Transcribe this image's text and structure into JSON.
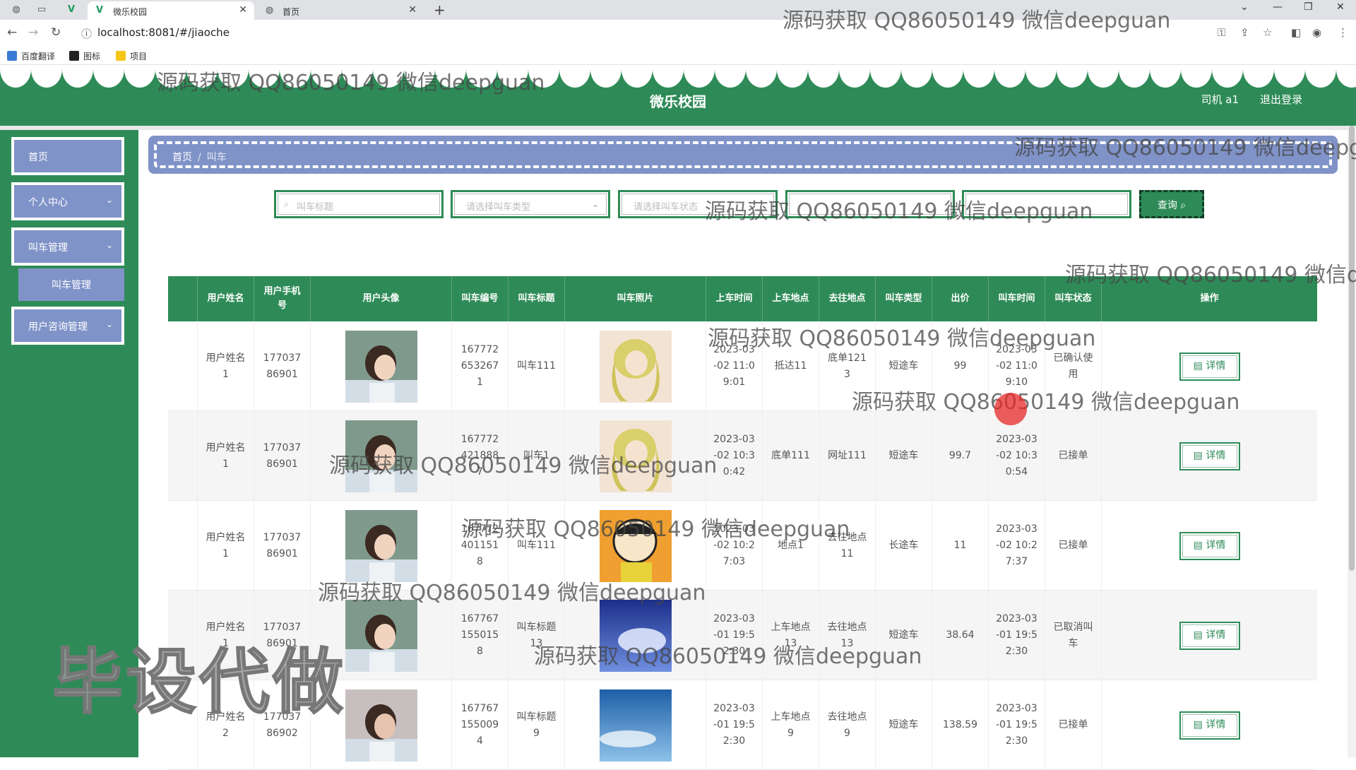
{
  "browser": {
    "tabs": [
      {
        "title": "微乐校园",
        "active": true
      },
      {
        "title": "首页",
        "active": false
      }
    ],
    "url": "localhost:8081/#/jiaoche",
    "bookmarks": [
      "百度翻译",
      "图标",
      "项目"
    ]
  },
  "header": {
    "title": "微乐校园",
    "user": "司机 a1",
    "logout": "退出登录"
  },
  "sidebar": {
    "items": [
      {
        "label": "首页",
        "has_children": false
      },
      {
        "label": "个人中心",
        "has_children": true
      },
      {
        "label": "叫车管理",
        "has_children": true
      },
      {
        "label": "用户咨询管理",
        "has_children": true
      }
    ],
    "sub_item": "叫车管理"
  },
  "breadcrumb": {
    "home": "首页",
    "separator": "/",
    "current": "叫车"
  },
  "search": {
    "title_placeholder": "叫车标题",
    "type_placeholder": "请选择叫车类型",
    "status_placeholder": "请选择叫车状态",
    "field4_placeholder": "",
    "field5_placeholder": "",
    "button": "查询"
  },
  "table": {
    "headers": [
      "用户姓名",
      "用户手机号",
      "用户头像",
      "叫车编号",
      "叫车标题",
      "叫车照片",
      "上车时间",
      "上车地点",
      "去往地点",
      "叫车类型",
      "出价",
      "叫车时间",
      "叫车状态",
      "操作"
    ],
    "action_label": "详情",
    "rows": [
      {
        "name": "用户姓名1",
        "phone": "17703786901",
        "no": "1677726532671",
        "title": "叫车111",
        "board_time": "2023-03-02 11:09:01",
        "from": "抵达11",
        "to": "底单1213",
        "type": "短途车",
        "price": "99",
        "call_time": "2023-03-02 11:09:10",
        "status": "已确认使用"
      },
      {
        "name": "用户姓名1",
        "phone": "17703786901",
        "no": "1677724218887",
        "title": "叫车1",
        "board_time": "2023-03-02 10:30:42",
        "from": "底单111",
        "to": "网址111",
        "type": "短途车",
        "price": "99.7",
        "call_time": "2023-03-02 10:30:54",
        "status": "已接单"
      },
      {
        "name": "用户姓名1",
        "phone": "17703786901",
        "no": "1677724011518",
        "title": "叫车111",
        "board_time": "2023-03-02 10:27:03",
        "from": "地点1",
        "to": "去往地点11",
        "type": "长途车",
        "price": "11",
        "call_time": "2023-03-02 10:27:37",
        "status": "已接单"
      },
      {
        "name": "用户姓名1",
        "phone": "17703786901",
        "no": "1677671550158",
        "title": "叫车标题13",
        "board_time": "2023-03-01 19:52:30",
        "from": "上车地点13",
        "to": "去往地点13",
        "type": "短途车",
        "price": "38.64",
        "call_time": "2023-03-01 19:52:30",
        "status": "已取消叫车"
      },
      {
        "name": "用户姓名2",
        "phone": "17703786902",
        "no": "1677671550094",
        "title": "叫车标题9",
        "board_time": "2023-03-01 19:52:30",
        "from": "上车地点9",
        "to": "去往地点9",
        "type": "短途车",
        "price": "138.59",
        "call_time": "2023-03-01 19:52:30",
        "status": "已接单"
      }
    ]
  },
  "watermarks": {
    "text": "源码获取 QQ86050149 微信deepguan",
    "text_cut1": "源码获取 QQ86050149 微信deepg",
    "text_cut2": "源码获取 QQ86050149 微信d",
    "big": "毕设代做"
  },
  "colors": {
    "primary_green": "#2e8b57",
    "nav_blue": "#8093c8"
  }
}
